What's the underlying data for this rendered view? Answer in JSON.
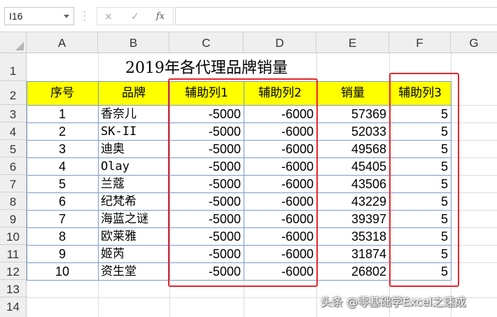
{
  "formula_bar": {
    "name_box": "I16",
    "cancel_icon": "×",
    "enter_icon": "✓",
    "fx_label": "fx",
    "formula": ""
  },
  "columns": [
    "A",
    "B",
    "C",
    "D",
    "E",
    "F",
    "G"
  ],
  "rows": [
    "1",
    "2",
    "3",
    "4",
    "5",
    "6",
    "7",
    "8",
    "9",
    "10",
    "11",
    "12",
    "13",
    "14"
  ],
  "sheet": {
    "title": "2019年各代理品牌销量",
    "headers": [
      "序号",
      "品牌",
      "辅助列1",
      "辅助列2",
      "销量",
      "辅助列3"
    ],
    "records": [
      {
        "idx": "1",
        "brand": "香奈儿",
        "aux1": "-5000",
        "aux2": "-6000",
        "sales": "57369",
        "aux3": "5"
      },
      {
        "idx": "2",
        "brand": "SK-II",
        "aux1": "-5000",
        "aux2": "-6000",
        "sales": "52033",
        "aux3": "5"
      },
      {
        "idx": "3",
        "brand": "迪奥",
        "aux1": "-5000",
        "aux2": "-6000",
        "sales": "49568",
        "aux3": "5"
      },
      {
        "idx": "4",
        "brand": "Olay",
        "aux1": "-5000",
        "aux2": "-6000",
        "sales": "45405",
        "aux3": "5"
      },
      {
        "idx": "5",
        "brand": "兰蔻",
        "aux1": "-5000",
        "aux2": "-6000",
        "sales": "43506",
        "aux3": "5"
      },
      {
        "idx": "6",
        "brand": "纪梵希",
        "aux1": "-5000",
        "aux2": "-6000",
        "sales": "43229",
        "aux3": "5"
      },
      {
        "idx": "7",
        "brand": "海蓝之谜",
        "aux1": "-5000",
        "aux2": "-6000",
        "sales": "39397",
        "aux3": "5"
      },
      {
        "idx": "8",
        "brand": "欧莱雅",
        "aux1": "-5000",
        "aux2": "-6000",
        "sales": "35318",
        "aux3": "5"
      },
      {
        "idx": "9",
        "brand": "姬芮",
        "aux1": "-5000",
        "aux2": "-6000",
        "sales": "31874",
        "aux3": "5"
      },
      {
        "idx": "10",
        "brand": "资生堂",
        "aux1": "-5000",
        "aux2": "-6000",
        "sales": "26802",
        "aux3": "5"
      }
    ]
  },
  "colors": {
    "header_fill": "#ffff00",
    "highlight_border": "#e8252b",
    "table_border": "#7b9bc8"
  },
  "watermark": "头条 @零基础学Excel之速成"
}
